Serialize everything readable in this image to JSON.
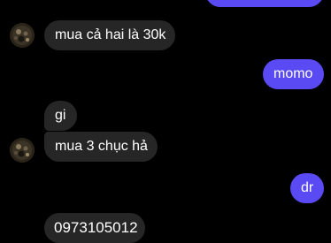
{
  "colors": {
    "background": "#000000",
    "incoming_bubble": "#262626",
    "outgoing_bubble": "#5a4af4",
    "text": "#ffffff"
  },
  "messages": [
    {
      "sender": "me",
      "text": ""
    },
    {
      "sender": "them",
      "text": "mua cả hai là 30k"
    },
    {
      "sender": "me",
      "text": "momo"
    },
    {
      "sender": "them",
      "text": "gi"
    },
    {
      "sender": "them",
      "text": "mua 3 chục hả"
    },
    {
      "sender": "me",
      "text": "dr"
    },
    {
      "sender": "them",
      "text": "0973105012"
    }
  ],
  "contact": {
    "avatar_icon": "contact-avatar-icon"
  }
}
